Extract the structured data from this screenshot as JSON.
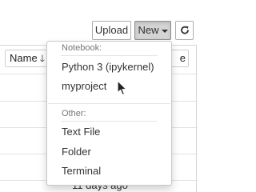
{
  "toolbar": {
    "upload_label": "Upload",
    "new_label": "New",
    "refresh_icon": "refresh-icon"
  },
  "file_list": {
    "sort_name_label": "Name",
    "sort_arrow": "🡓",
    "sort_right_label": "e",
    "row_time": "11 days ago"
  },
  "new_menu": {
    "notebook_header": "Notebook:",
    "notebook_items": [
      "Python 3 (ipykernel)",
      "myproject"
    ],
    "other_header": "Other:",
    "other_items": [
      "Text File",
      "Folder",
      "Terminal"
    ]
  }
}
